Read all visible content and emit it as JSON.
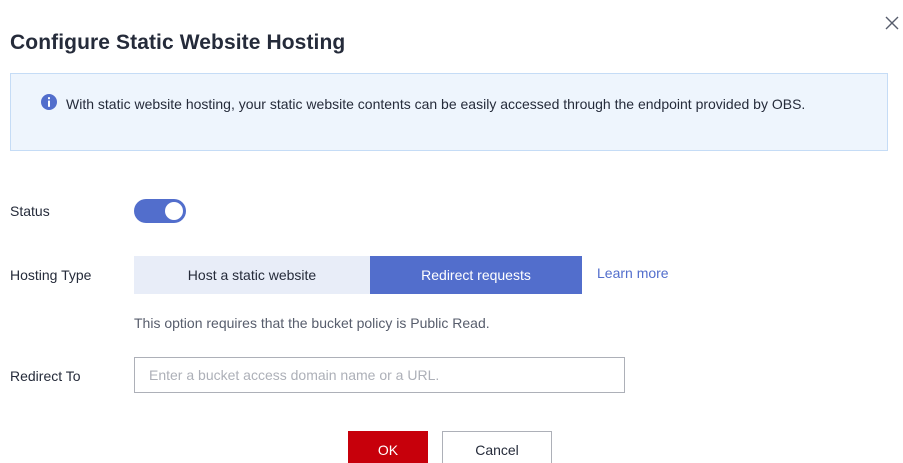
{
  "dialog": {
    "title": "Configure Static Website Hosting",
    "close_icon": "close-icon"
  },
  "info": {
    "icon": "info-icon",
    "text": "With static website hosting, your static website contents can be easily accessed through the endpoint provided by OBS."
  },
  "status": {
    "label": "Status",
    "enabled": true
  },
  "hosting_type": {
    "label": "Hosting Type",
    "options": [
      "Host a static website",
      "Redirect requests"
    ],
    "selected": "Redirect requests",
    "learn_more": "Learn more",
    "hint": "This option requires that the bucket policy is Public Read."
  },
  "redirect": {
    "label": "Redirect To",
    "value": "",
    "placeholder": "Enter a bucket access domain name or a URL."
  },
  "buttons": {
    "ok": "OK",
    "cancel": "Cancel"
  },
  "colors": {
    "primary": "#526ecc",
    "danger": "#c7000b",
    "info_bg": "#eef5fd",
    "info_border": "#c5dcf6"
  }
}
